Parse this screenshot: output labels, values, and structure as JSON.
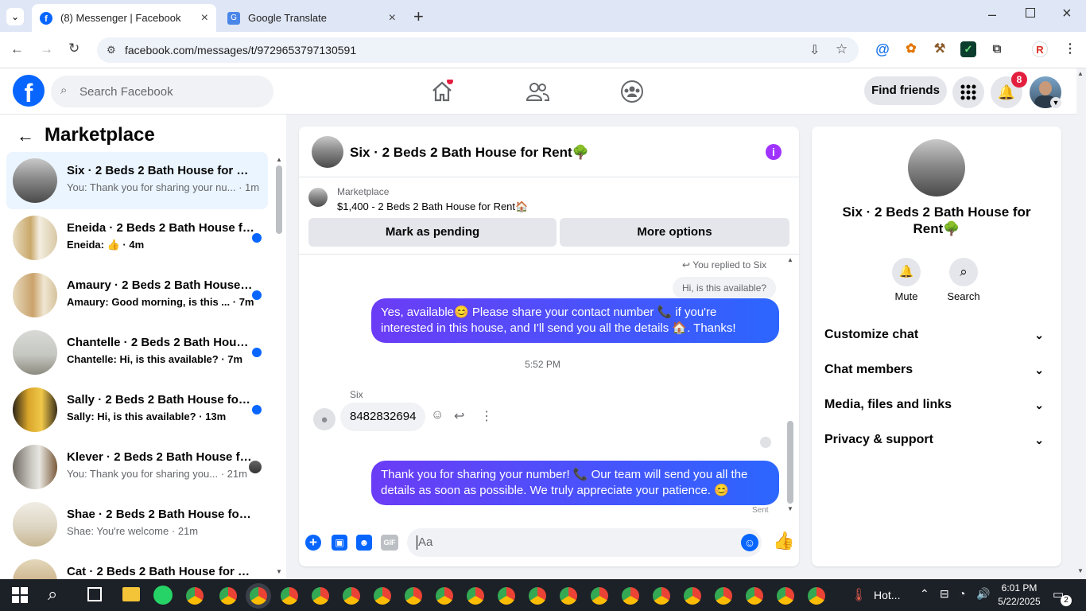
{
  "browser": {
    "tabs": [
      {
        "title": "(8) Messenger | Facebook"
      },
      {
        "title": "Google Translate"
      }
    ],
    "url": "facebook.com/messages/t/9729653797130591"
  },
  "facebook": {
    "search_placeholder": "Search Facebook",
    "find_friends": "Find friends",
    "notification_count": "8"
  },
  "sidebar": {
    "title": "Marketplace",
    "conversations": [
      {
        "name": "Six · 2 Beds 2 Bath House for Rent",
        "preview": "You: Thank you for sharing your nu...",
        "time": "1m"
      },
      {
        "name": "Eneida · 2 Beds 2 Bath House for Rent",
        "preview_prefix": "Eneida:",
        "time": "4m"
      },
      {
        "name": "Amaury · 2 Beds 2 Bath House for Rent",
        "preview": "Amaury: Good morning, is this ...",
        "time": "7m"
      },
      {
        "name": "Chantelle · 2 Beds 2 Bath House for Rent",
        "preview": "Chantelle: Hi, is this available?",
        "time": "7m"
      },
      {
        "name": "Sally · 2 Beds 2 Bath House for Rent",
        "preview": "Sally: Hi, is this available?",
        "time": "13m"
      },
      {
        "name": "Klever · 2 Beds 2 Bath House for Rent",
        "preview": "You: Thank you for sharing you...",
        "time": "21m"
      },
      {
        "name": "Shae · 2 Beds 2 Bath House for Rent",
        "preview": "Shae: You're welcome",
        "time": "21m"
      },
      {
        "name": "Cat · 2 Beds 2 Bath House for Rent",
        "preview": "",
        "time": ""
      }
    ]
  },
  "chat": {
    "title": "Six · 2 Beds 2 Bath House for Rent🌳",
    "marketplace_label": "Marketplace",
    "listing": "$1,400 - 2 Beds 2 Bath House for Rent🏠",
    "mark_pending": "Mark as pending",
    "more_options": "More options",
    "replied_to": "You replied to Six",
    "quoted": "Hi, is this available?",
    "msg1": "Yes, available😊 Please share your contact number 📞 if you're interested in this house, and I'll send you all the details 🏠. Thanks!",
    "timestamp": "5:52 PM",
    "sender": "Six",
    "their_msg": "8482832694",
    "msg2": "Thank you for sharing your number! 📞 Our team will send you all the details as soon as possible. We truly appreciate your patience. 😊",
    "sent_status": "Sent",
    "input_placeholder": "Aa",
    "gif_label": "GIF"
  },
  "right_panel": {
    "name": "Six · 2 Beds 2 Bath House for Rent🌳",
    "mute": "Mute",
    "search": "Search",
    "sections": [
      "Customize chat",
      "Chat members",
      "Media, files and links",
      "Privacy & support"
    ]
  },
  "taskbar": {
    "weather": "Hot...",
    "time": "6:01 PM",
    "date": "5/22/2025",
    "notif_count": "2"
  }
}
